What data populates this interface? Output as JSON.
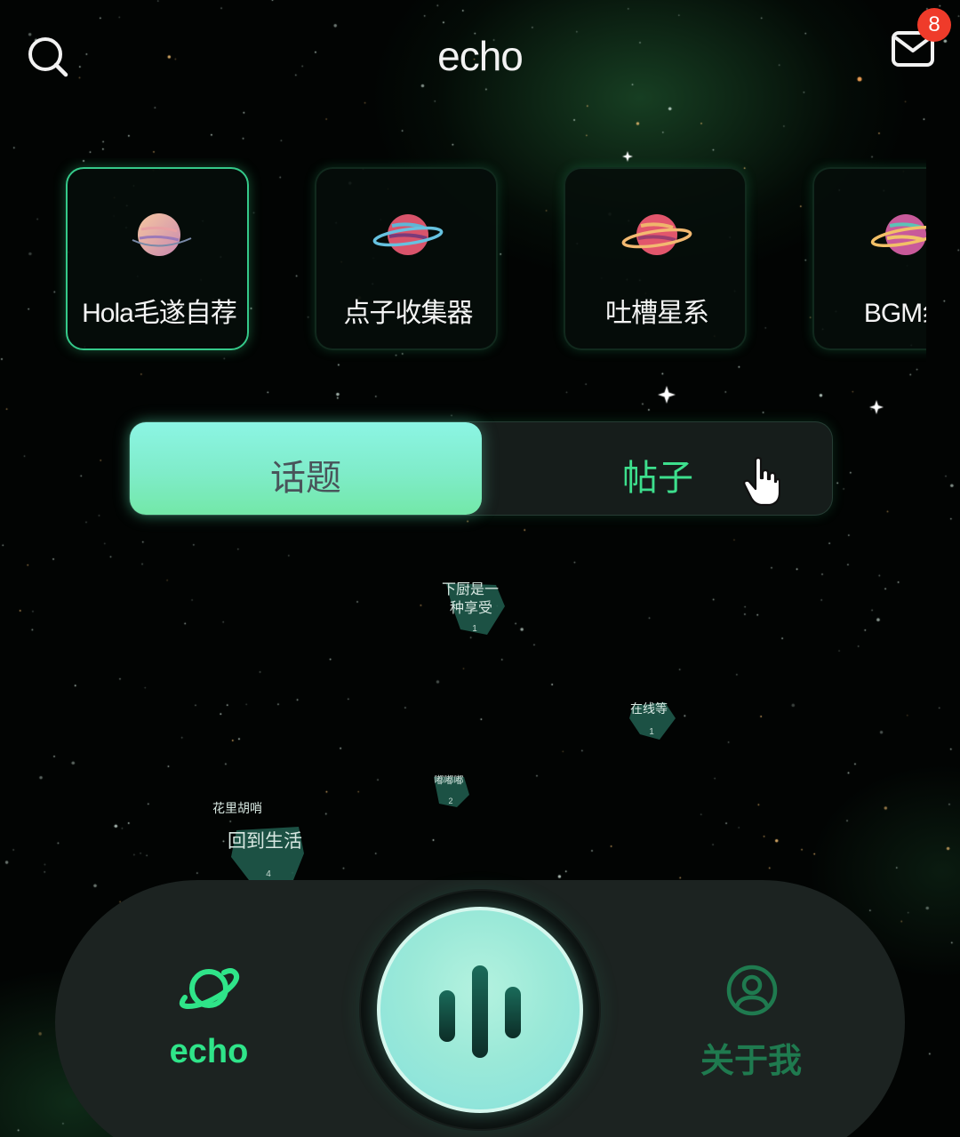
{
  "header": {
    "title": "echo",
    "unread_count": "8"
  },
  "categories": [
    {
      "label": "Hola毛遂自荐",
      "active": true,
      "planet_colors": [
        "#f2b79a",
        "#c98ab0"
      ]
    },
    {
      "label": "点子收集器",
      "active": false,
      "planet_colors": [
        "#d9546b",
        "#5fb6d6"
      ]
    },
    {
      "label": "吐槽星系",
      "active": false,
      "planet_colors": [
        "#e2566c",
        "#f0b46c"
      ]
    },
    {
      "label": "BGM纟",
      "active": false,
      "planet_colors": [
        "#c85a9a",
        "#5cc2b6"
      ]
    }
  ],
  "tabs": {
    "topic": "话题",
    "post": "帖子",
    "selected": "topic"
  },
  "bubbles": [
    {
      "text_line1": "下厨是一",
      "text_line2": "种享受",
      "count": "1"
    },
    {
      "text_line1": "在线等",
      "text_line2": "",
      "count": "1"
    },
    {
      "text_line1": "嘟嘟嘟",
      "text_line2": "",
      "count": "2"
    },
    {
      "text_line1": "花里胡哨",
      "text_line2": "",
      "count": ""
    },
    {
      "text_line1": "回到生活",
      "text_line2": "",
      "count": "4"
    }
  ],
  "nav": {
    "echo_label": "echo",
    "me_label": "关于我"
  },
  "colors": {
    "accent": "#2fe489",
    "nav_bg": "#1c2321",
    "badge": "#ef3b2a"
  },
  "icons": {
    "search": "search-icon",
    "mail": "mail-icon",
    "nav_echo": "planet-icon",
    "nav_me": "user-circle-icon",
    "record": "voice-wave-icon"
  }
}
